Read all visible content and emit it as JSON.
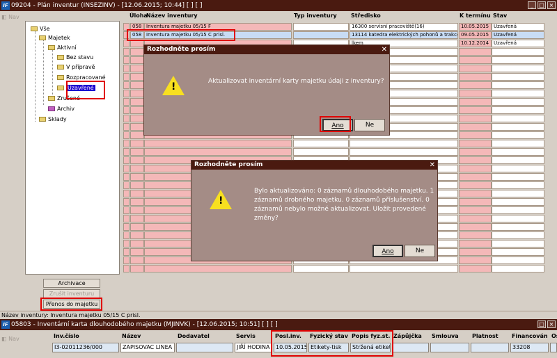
{
  "window1": {
    "title": "09204 - Plán inventur (INSEZINV) - [12.06.2015; 10:44]  [ ]  [ ]",
    "logo": "IF"
  },
  "nav_label": "Nav",
  "tree": [
    {
      "label": "Vše"
    },
    {
      "label": "Majetek"
    },
    {
      "label": "Aktivní"
    },
    {
      "label": "Bez stavu"
    },
    {
      "label": "V přípravě"
    },
    {
      "label": "Rozpracované"
    },
    {
      "label": "Uzavřené"
    },
    {
      "label": "Zrušené"
    },
    {
      "label": "Archiv"
    },
    {
      "label": "Sklady"
    }
  ],
  "buttons": {
    "archive": "Archivace",
    "cancel_inv": "Zrušit inventuru",
    "transfer": "Přenos do majetku"
  },
  "grid": {
    "headers": {
      "uloha": "Úloha",
      "nazev": "Název inventury",
      "typ": "Typ inventury",
      "stredisko": "Středisko",
      "termin": "K termínu",
      "stav": "Stav"
    },
    "rows": [
      {
        "uloha": "058",
        "nazev": "Inventura majetku 05/15 F",
        "typ": "",
        "stredisko": "16300 servisní pracoviště(16)",
        "termin": "10.05.2015",
        "stav": "Uzavřená"
      },
      {
        "uloha": "058",
        "nazev": "Inventura majetku 05/15 C prisl.",
        "typ": "",
        "stredisko": "13114 katedra elektrických pohonů a trakce",
        "termin": "09.05.2015",
        "stav": "Uzavřená"
      },
      {
        "uloha": "",
        "nazev": "",
        "typ": "",
        "stredisko": "lkem",
        "termin": "10.12.2014",
        "stav": "Uzavřená"
      }
    ]
  },
  "status_text": "Název inventury: Inventura majetku 05/15 C prisl.",
  "window2": {
    "title": "05803 - Inventární karta dlouhodobého majetku (MJINVK) - [12.06.2015; 10:51]  [ ]  [ ]",
    "headers": [
      "Inv.číslo",
      "Název",
      "Dodavatel",
      "Servis",
      "Posl.inv.",
      "Fyzický stav",
      "Popis fyz.st.",
      "Zápůjčka",
      "Smlouva",
      "Platnost",
      "Financován",
      "Os"
    ],
    "values": [
      "I3-02011236/000",
      "ZAPISOVAC LINEA",
      "",
      "JIŘÍ HODINA",
      "10.05.2015",
      "Etikety-tisk",
      "Stržená etiket",
      "",
      "",
      "",
      "33208",
      ""
    ]
  },
  "dialog1": {
    "title": "Rozhodněte prosím",
    "message": "Aktualizovat inventární karty majetku údaji z inventury?",
    "yes": "Ano",
    "no": "Ne"
  },
  "dialog2": {
    "title": "Rozhodněte prosím",
    "line1": "Bylo aktualizováno: 0 záznamů dlouhodobého majetku. 1",
    "line2": "záznamů drobného majetku. 0 záznamů příslušenství. 0",
    "line3": "záznamů nebylo možné aktualizovat. Uložit provedené",
    "line4": "změny?",
    "yes": "Ano",
    "no": "Ne"
  },
  "colors": {
    "title_bg": "#4a1a10",
    "pink": "#f4b8b8",
    "selection": "#1a00d0",
    "highlight": "#e00000"
  }
}
